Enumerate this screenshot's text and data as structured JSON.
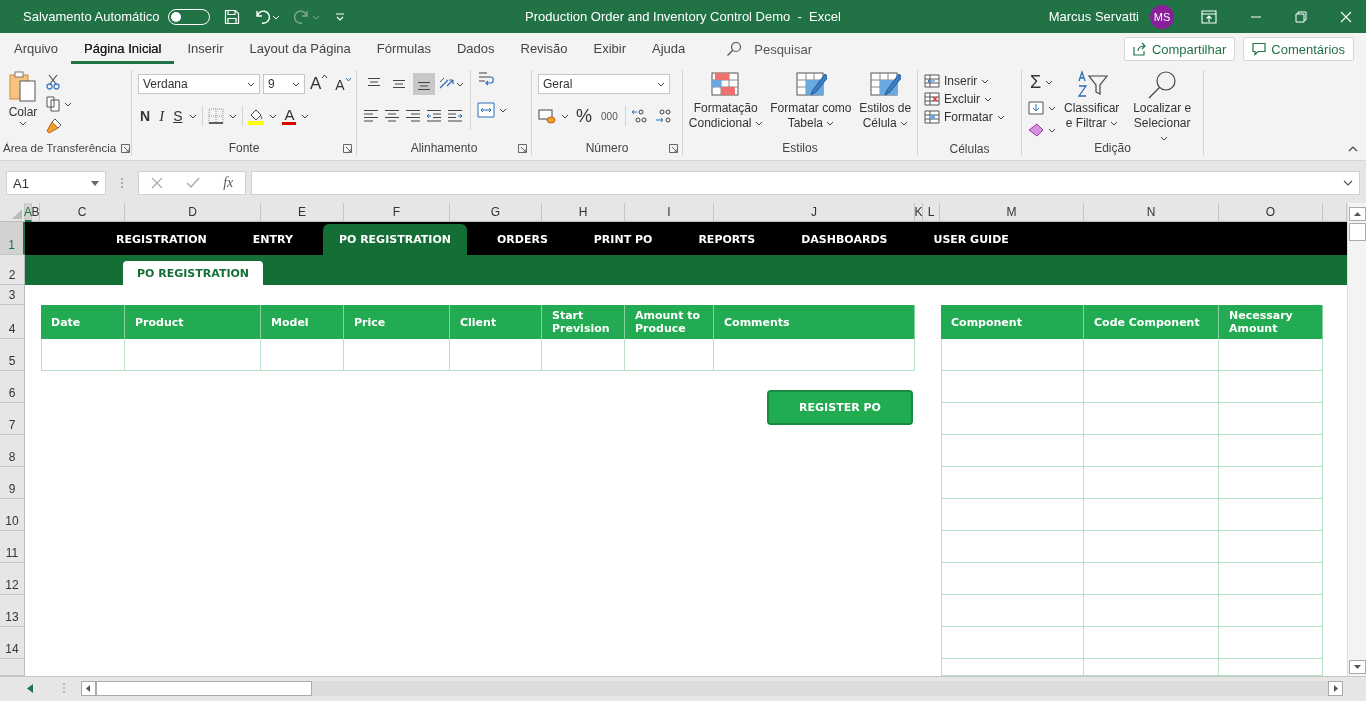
{
  "title_bar": {
    "autosave_label": "Salvamento Automático",
    "autosave_on": false,
    "title": "Production Order and Inventory Control Demo  -  Excel",
    "user": "Marcus Servatti",
    "avatar": "MS"
  },
  "ribbon_tabs": [
    {
      "label": "Arquivo",
      "selected": false
    },
    {
      "label": "Página Inicial",
      "selected": true
    },
    {
      "label": "Inserir",
      "selected": false
    },
    {
      "label": "Layout da Página",
      "selected": false
    },
    {
      "label": "Fórmulas",
      "selected": false
    },
    {
      "label": "Dados",
      "selected": false
    },
    {
      "label": "Revisão",
      "selected": false
    },
    {
      "label": "Exibir",
      "selected": false
    },
    {
      "label": "Ajuda",
      "selected": false
    }
  ],
  "search": {
    "placeholder": "Pesquisar"
  },
  "share_button": "Compartilhar",
  "comments_button": "Comentários",
  "ribbon_groups": [
    {
      "label": "Área de Transferência",
      "buttons": [
        "Colar"
      ]
    },
    {
      "label": "Fonte",
      "font": "Verdana",
      "size": "9",
      "grow_font": "A",
      "shrink_font": "A",
      "bold": "N",
      "italic": "I",
      "underline": "S",
      "font_color": "A"
    },
    {
      "label": "Alinhamento",
      "vertical_align": [
        {
          "selected": false
        },
        {
          "selected": false
        },
        {
          "selected": true
        }
      ]
    },
    {
      "label": "Número",
      "format": "Geral",
      "percent": "%",
      "thousands": "000"
    },
    {
      "label": "Estilos",
      "buttons": [
        "Formatação\nCondicional",
        "Formatar como\nTabela",
        "Estilos de\nCélula"
      ]
    },
    {
      "label": "Células",
      "buttons": [
        "Inserir",
        "Excluir",
        "Formatar"
      ]
    },
    {
      "label": "Edição",
      "sum": "Σ",
      "buttons": [
        "Classificar\ne Filtrar",
        "Localizar e\nSelecionar"
      ]
    }
  ],
  "formula_bar": {
    "name_box": "A1",
    "function_label": "fx"
  },
  "sheet": {
    "columns": [
      {
        "label": "A",
        "selected": true
      },
      {
        "label": "B",
        "selected": false
      },
      {
        "label": "C",
        "selected": false
      },
      {
        "label": "D",
        "selected": false
      },
      {
        "label": "E",
        "selected": false
      },
      {
        "label": "F",
        "selected": false
      },
      {
        "label": "G",
        "selected": false
      },
      {
        "label": "H",
        "selected": false
      },
      {
        "label": "I",
        "selected": false
      },
      {
        "label": "J",
        "selected": false
      },
      {
        "label": "K",
        "selected": false
      },
      {
        "label": "L",
        "selected": false
      },
      {
        "label": "M",
        "selected": false
      },
      {
        "label": "N",
        "selected": false
      },
      {
        "label": "O",
        "selected": false
      }
    ],
    "rows": [
      {
        "label": "1",
        "selected": true
      },
      {
        "label": "2",
        "selected": false
      },
      {
        "label": "3",
        "selected": false
      },
      {
        "label": "4",
        "selected": false
      },
      {
        "label": "5",
        "selected": false
      },
      {
        "label": "6",
        "selected": false
      },
      {
        "label": "7",
        "selected": false
      },
      {
        "label": "8",
        "selected": false
      },
      {
        "label": "9",
        "selected": false
      },
      {
        "label": "10",
        "selected": false
      },
      {
        "label": "11",
        "selected": false
      },
      {
        "label": "12",
        "selected": false
      },
      {
        "label": "13",
        "selected": false
      },
      {
        "label": "14",
        "selected": false
      }
    ]
  },
  "nav_tabs": [
    {
      "label": "REGISTRATION",
      "selected": false
    },
    {
      "label": "ENTRY",
      "selected": false
    },
    {
      "label": "PO REGISTRATION",
      "selected": true
    },
    {
      "label": "ORDERS",
      "selected": false
    },
    {
      "label": "PRINT PO",
      "selected": false
    },
    {
      "label": "REPORTS",
      "selected": false
    },
    {
      "label": "DASHBOARDS",
      "selected": false
    },
    {
      "label": "USER GUIDE",
      "selected": false
    }
  ],
  "sub_tab": "PO REGISTRATION",
  "po_table": {
    "columns": [
      "Date",
      "Product",
      "Model",
      "Price",
      "Client",
      "Start Prevision",
      "Amount to Produce",
      "Comments"
    ]
  },
  "components_table": {
    "columns": [
      "Component",
      "Code Component",
      "Necessary Amount"
    ]
  },
  "register_button": "REGISTER PO"
}
